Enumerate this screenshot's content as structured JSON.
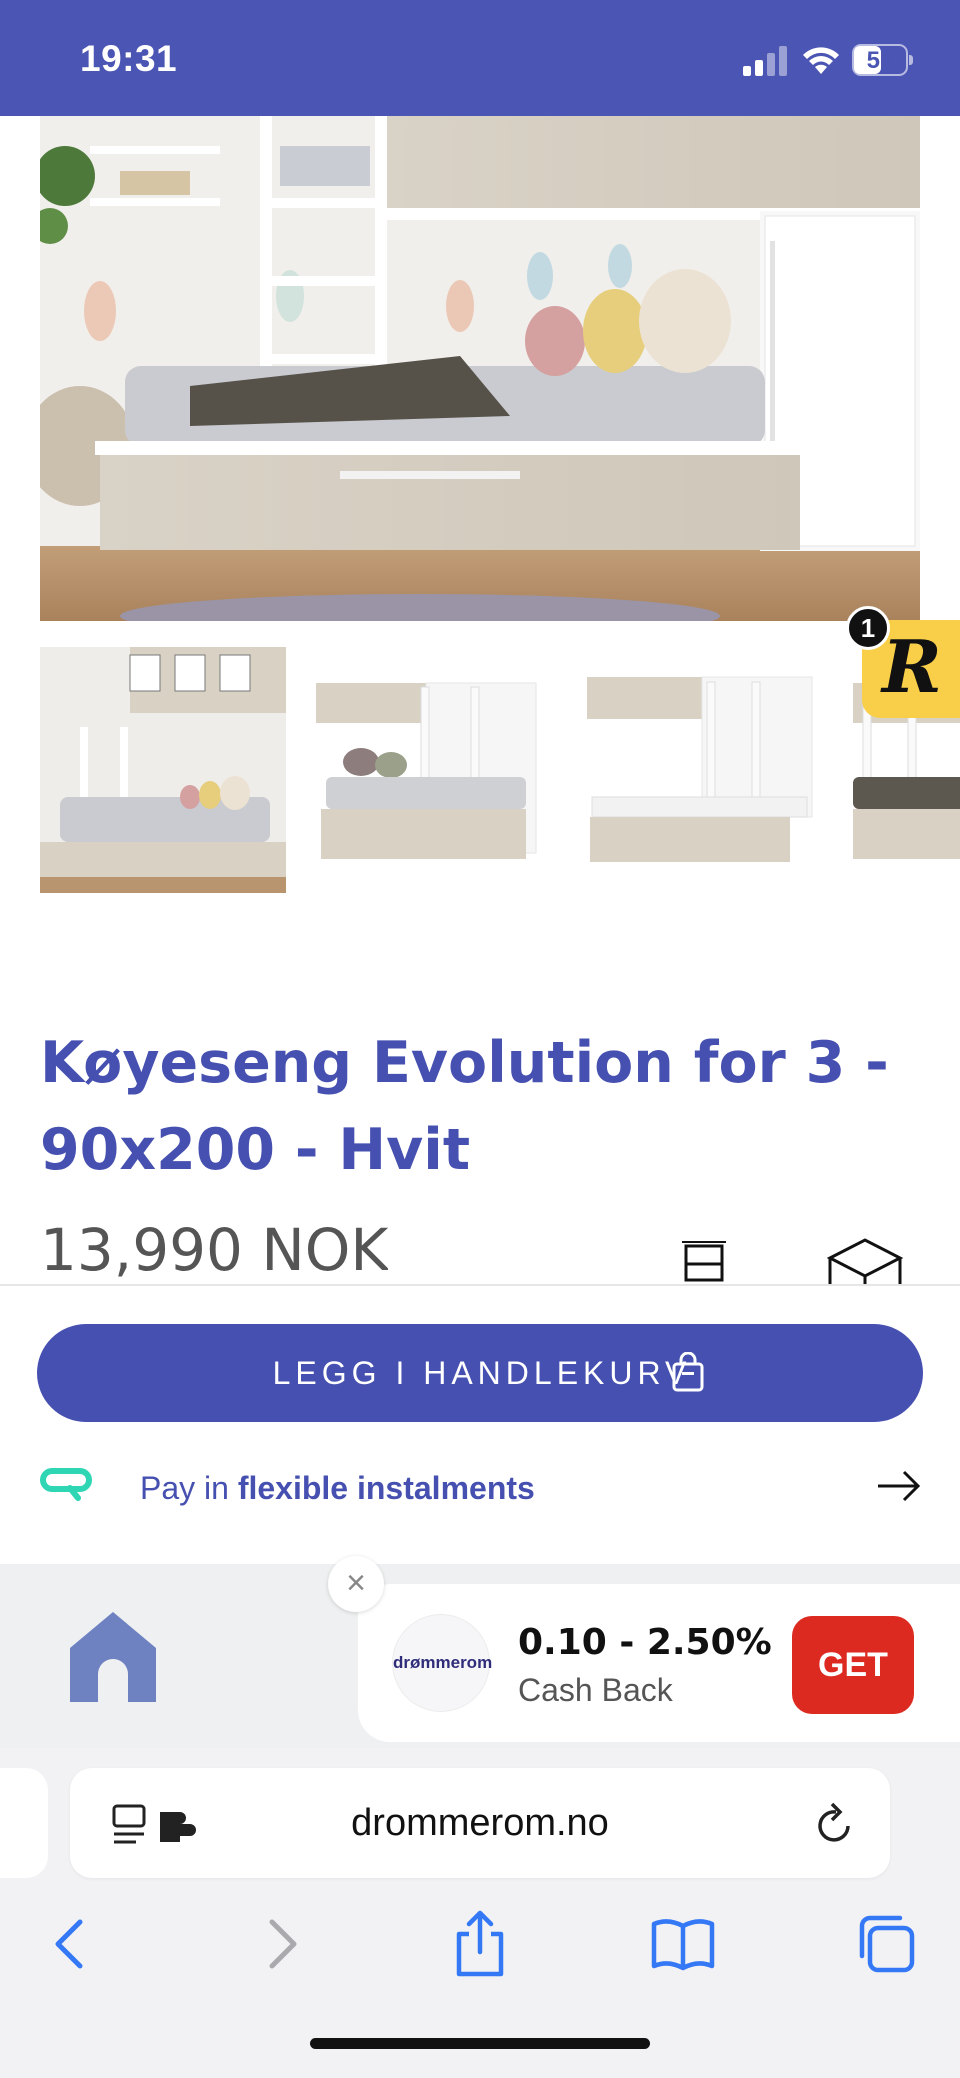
{
  "status_bar": {
    "time": "19:31",
    "battery_percent": "51",
    "battery_level": 0.51,
    "signal_bars_active": 2,
    "signal_bars_total": 4
  },
  "gallery": {
    "thumbnail_count_visible": 4
  },
  "badge": {
    "letter": "R",
    "count": "1"
  },
  "product": {
    "title_line1": "Køyeseng Evolution for 3 -",
    "title_line2": "90x200 - Hvit",
    "price": "13,990 NOK"
  },
  "cta": {
    "add_to_cart_label": "LEGG I HANDLEKURV",
    "installments_prefix": "Pay in",
    "installments_bold": "flexible instalments"
  },
  "cashback": {
    "store_logo_text": "drømmerom",
    "rate": "0.10 - 2.50%",
    "label": "Cash Back",
    "get_label": "GET",
    "close_symbol": "×"
  },
  "browser": {
    "url": "drommerom.no"
  },
  "colors": {
    "brand": "#4650b0",
    "status_bar": "#4b55b3",
    "get_button": "#dc2a21",
    "installment_logo": "#2fd6b4",
    "badge": "#f9cf4a"
  },
  "icons": {
    "signal": "cellular-signal-icon",
    "wifi": "wifi-icon",
    "battery": "battery-icon",
    "bag": "shopping-bag-icon",
    "arrow": "arrow-right-icon",
    "home": "home-icon",
    "reader": "reader-mode-icon",
    "reload": "reload-icon",
    "back": "chevron-left-icon",
    "forward": "chevron-right-icon",
    "share": "share-icon",
    "bookmarks": "book-icon",
    "tabs": "tabs-icon",
    "size": "dimensions-icon",
    "box": "package-icon"
  }
}
